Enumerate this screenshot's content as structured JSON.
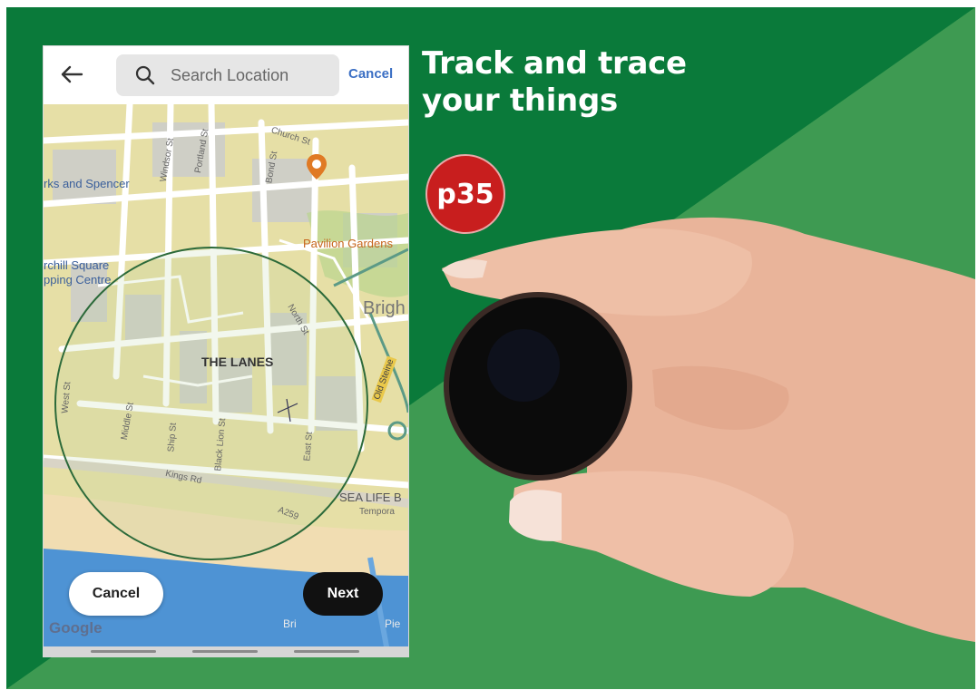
{
  "headline": {
    "line1": "Track and trace",
    "line2": "your things"
  },
  "badge": {
    "text": "p35"
  },
  "colors": {
    "bg_green": "#0a7a3a",
    "light_green": "#3e9a52",
    "badge_red": "#c81e1e",
    "water": "#4e93d4",
    "park_yellow": "#e7dca2"
  },
  "app": {
    "back_icon": "arrow-left-icon",
    "search": {
      "icon": "magnifier-icon",
      "placeholder": "Search Location"
    },
    "top_cancel": "Cancel",
    "map": {
      "place_labels": [
        "rks and Spencer",
        "Pavilion Gardens",
        "rchill Square",
        "pping Centre",
        "THE LANES",
        "Brigh",
        "SEA LIFE B",
        "Tempora",
        "Bri",
        "Pie"
      ],
      "street_labels": [
        "Church St",
        "Windsor St",
        "Portland St",
        "Bond St",
        "North St",
        "Middle St",
        "Ship St",
        "Black Lion St",
        "East St",
        "Kings Rd",
        "Old Steine",
        "West St",
        "A259"
      ],
      "pin_icon": "food-pin-icon"
    },
    "buttons": {
      "cancel": "Cancel",
      "next": "Next"
    },
    "attribution": "Google"
  },
  "device": {
    "icon": "round-tracker-tag"
  }
}
